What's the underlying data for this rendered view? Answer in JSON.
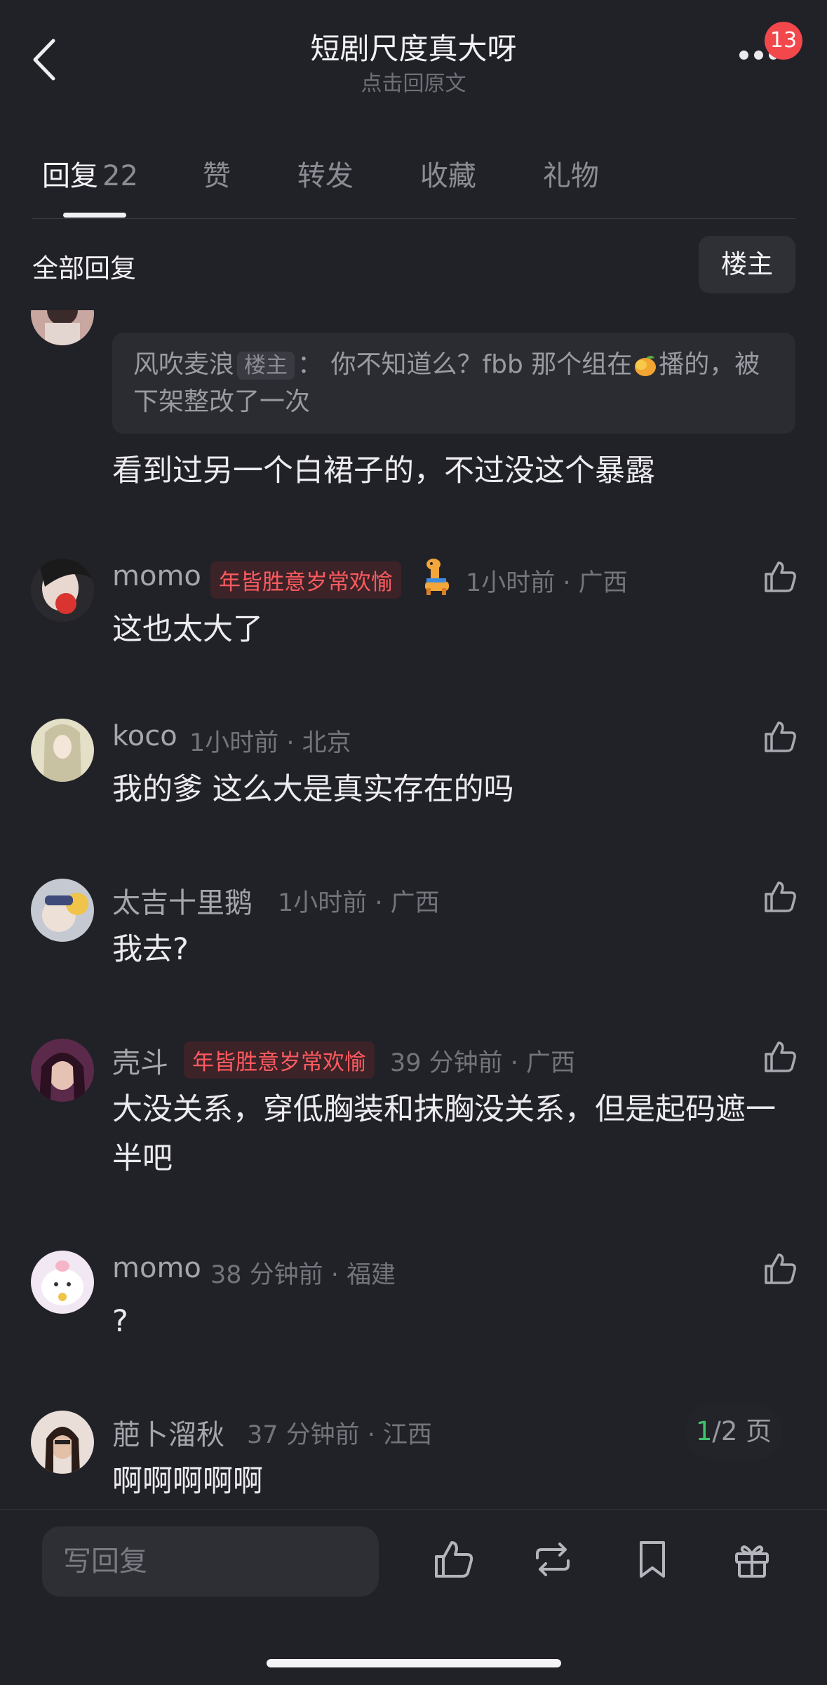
{
  "header": {
    "title": "短剧尺度真大呀",
    "subtitle": "点击回原文",
    "notification_count": "13"
  },
  "tabs": [
    {
      "label": "回复",
      "count": "22"
    },
    {
      "label": "赞"
    },
    {
      "label": "转发"
    },
    {
      "label": "收藏"
    },
    {
      "label": "礼物"
    }
  ],
  "filter": {
    "all_label": "全部回复",
    "owner_label": "楼主"
  },
  "quoted": {
    "name": "风吹麦浪",
    "owner_badge": "楼主",
    "text_before": "： 你不知道么？fbb 那个组在",
    "text_after": "播的，被下架整改了一次"
  },
  "first_comment_text": "看到过另一个白裙子的，不过没这个暴露",
  "comments": [
    {
      "name": "momo",
      "tag": "年皆胜意岁常欢愉",
      "meta": "1小时前 · 广西",
      "text": "这也太大了"
    },
    {
      "name": "koco",
      "meta": "1小时前 · 北京",
      "text": "我的爹 这么大是真实存在的吗"
    },
    {
      "name": "太吉十里鹅",
      "meta": "1小时前 · 广西",
      "text": "我去?"
    },
    {
      "name": "壳斗",
      "tag": "年皆胜意岁常欢愉",
      "meta": "39 分钟前 · 广西",
      "text": "大没关系，穿低胸装和抹胸没关系，但是起码遮一半吧"
    },
    {
      "name": "momo",
      "meta": "38 分钟前 · 福建",
      "text": "?"
    },
    {
      "name": "萉卜溜秋",
      "meta": "37 分钟前 · 江西",
      "text": "啊啊啊啊啊"
    }
  ],
  "pager": {
    "current": "1",
    "rest": "/2 页"
  },
  "bottom": {
    "reply_placeholder": "写回复"
  },
  "colors": {
    "background": "#212128",
    "tag_red": "#ff5a5f",
    "badge_red": "#f2474b",
    "pager_green": "#3fc46a"
  },
  "icons": [
    "back-arrow-icon",
    "more-icon",
    "thumbs-up-icon",
    "repost-icon",
    "bookmark-icon",
    "gift-icon"
  ]
}
